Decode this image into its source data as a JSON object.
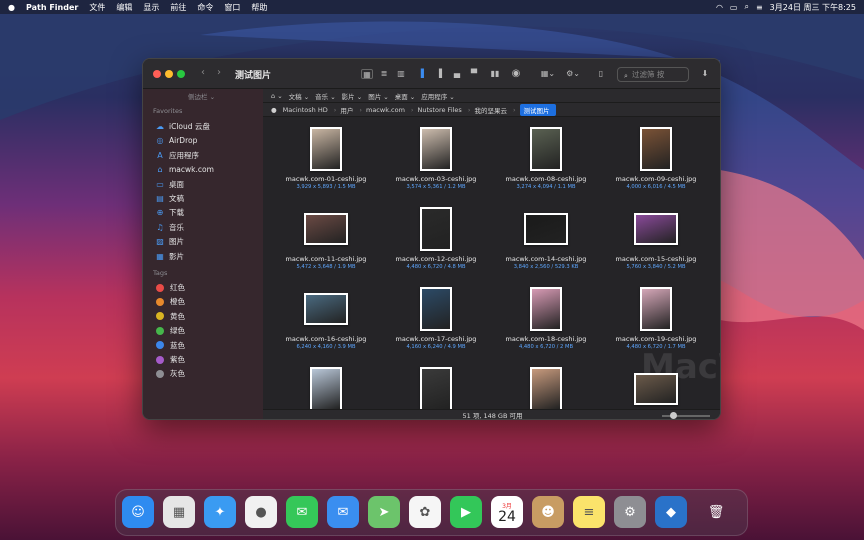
{
  "menubar": {
    "apple": "",
    "app_name": "Path Finder",
    "menus": [
      "文件",
      "编辑",
      "显示",
      "前往",
      "命令",
      "窗口",
      "帮助"
    ],
    "clock": "3月24日 周三 下午8:25"
  },
  "window": {
    "title": "测试图片",
    "search_placeholder": "过滤筛 按"
  },
  "sidebar": {
    "collapse_label": "侧边栏 ⌄",
    "favorites_header": "Favorites",
    "favorites": [
      {
        "label": "iCloud 云盘",
        "icon": "cloud-icon",
        "glyph": "☁"
      },
      {
        "label": "AirDrop",
        "icon": "airdrop-icon",
        "glyph": "◎"
      },
      {
        "label": "应用程序",
        "icon": "applications-icon",
        "glyph": "A"
      },
      {
        "label": "macwk.com",
        "icon": "home-icon",
        "glyph": "⌂"
      },
      {
        "label": "桌面",
        "icon": "desktop-icon",
        "glyph": "▭"
      },
      {
        "label": "文稿",
        "icon": "documents-icon",
        "glyph": "▤"
      },
      {
        "label": "下载",
        "icon": "downloads-icon",
        "glyph": "⊕"
      },
      {
        "label": "音乐",
        "icon": "music-icon",
        "glyph": "♫"
      },
      {
        "label": "图片",
        "icon": "pictures-icon",
        "glyph": "▨"
      },
      {
        "label": "影片",
        "icon": "movies-icon",
        "glyph": "▦"
      }
    ],
    "tags_header": "Tags",
    "tags": [
      {
        "label": "红色",
        "color": "#e94b47"
      },
      {
        "label": "橙色",
        "color": "#e8892c"
      },
      {
        "label": "黄色",
        "color": "#d9b422"
      },
      {
        "label": "绿色",
        "color": "#46b64b"
      },
      {
        "label": "蓝色",
        "color": "#3c86ea"
      },
      {
        "label": "紫色",
        "color": "#a65bc9"
      },
      {
        "label": "灰色",
        "color": "#8e8e93"
      }
    ]
  },
  "pathbar_top": [
    "文稿 ⌄",
    "音乐 ⌄",
    "影片 ⌄",
    "图片 ⌄",
    "桌面 ⌄",
    "应用程序 ⌄"
  ],
  "pathbar": [
    "Macintosh HD",
    "用户",
    "macwk.com",
    "Nutstore Files",
    "我的坚果云",
    "测试图片"
  ],
  "files": [
    {
      "name": "macwk.com-01-ceshi.jpg",
      "meta": "3,929 x 5,893 / 1.5 MB",
      "orient": "portrait",
      "color": "#c9b6a3"
    },
    {
      "name": "macwk.com-03-ceshi.jpg",
      "meta": "3,574 x 5,361 / 1.2 MB",
      "orient": "portrait",
      "color": "#cdbdae"
    },
    {
      "name": "macwk.com-08-ceshi.jpg",
      "meta": "3,274 x 4,094 / 1.1 MB",
      "orient": "portrait",
      "color": "#5a6152"
    },
    {
      "name": "macwk.com-09-ceshi.jpg",
      "meta": "4,000 x 6,016 / 4.5 MB",
      "orient": "portrait",
      "color": "#7a5236"
    },
    {
      "name": "macwk.com-11-ceshi.jpg",
      "meta": "5,472 x 3,648 / 1.9 MB",
      "orient": "landscape",
      "color": "#6b4a44"
    },
    {
      "name": "macwk.com-12-ceshi.jpg",
      "meta": "4,480 x 6,720 / 4.8 MB",
      "orient": "portrait",
      "color": "#2a2a2a"
    },
    {
      "name": "macwk.com-14-ceshi.jpg",
      "meta": "3,840 x 2,560 / 529.3 KB",
      "orient": "landscape",
      "color": "#1a1a1a"
    },
    {
      "name": "macwk.com-15-ceshi.jpg",
      "meta": "5,760 x 3,840 / 5.2 MB",
      "orient": "landscape",
      "color": "#8a4a9a"
    },
    {
      "name": "macwk.com-16-ceshi.jpg",
      "meta": "6,240 x 4,160 / 3.9 MB",
      "orient": "landscape",
      "color": "#4a6a80"
    },
    {
      "name": "macwk.com-17-ceshi.jpg",
      "meta": "4,160 x 6,240 / 4.9 MB",
      "orient": "portrait",
      "color": "#2c4a66"
    },
    {
      "name": "macwk.com-18-ceshi.jpg",
      "meta": "4,480 x 6,720 / 2 MB",
      "orient": "portrait",
      "color": "#d79ab4"
    },
    {
      "name": "macwk.com-19-ceshi.jpg",
      "meta": "4,480 x 6,720 / 1.7 MB",
      "orient": "portrait",
      "color": "#d5a7b8"
    },
    {
      "name": "",
      "meta": "",
      "orient": "portrait",
      "color": "#b9c7d8"
    },
    {
      "name": "",
      "meta": "",
      "orient": "portrait",
      "color": "#3a3a3a"
    },
    {
      "name": "",
      "meta": "",
      "orient": "portrait",
      "color": "#c79a7d"
    },
    {
      "name": "",
      "meta": "",
      "orient": "landscape",
      "color": "#6b5a4a"
    }
  ],
  "status": "51 项, 148 GB 可用",
  "watermark": "MacWk.com",
  "dock": [
    {
      "name": "finder-icon",
      "glyph": "☺",
      "bg": "#2e8bf0"
    },
    {
      "name": "launchpad-icon",
      "glyph": "▦",
      "bg": "#e6e6e6"
    },
    {
      "name": "safari-icon",
      "glyph": "✦",
      "bg": "#3a9bf2"
    },
    {
      "name": "chrome-icon",
      "glyph": "●",
      "bg": "#f1f1f1"
    },
    {
      "name": "messages-icon",
      "glyph": "✉",
      "bg": "#35c759"
    },
    {
      "name": "mail-icon",
      "glyph": "✉",
      "bg": "#3a8ef0"
    },
    {
      "name": "maps-icon",
      "glyph": "➤",
      "bg": "#6cc46b"
    },
    {
      "name": "photos-icon",
      "glyph": "✿",
      "bg": "#f6f6f6"
    },
    {
      "name": "facetime-icon",
      "glyph": "▶",
      "bg": "#33c759"
    },
    {
      "name": "calendar-icon",
      "glyph": "24",
      "bg": "#ffffff",
      "month": "3月"
    },
    {
      "name": "contacts-icon",
      "glyph": "☻",
      "bg": "#c89c63"
    },
    {
      "name": "notes-icon",
      "glyph": "≡",
      "bg": "#fbe36b"
    },
    {
      "name": "system-preferences-icon",
      "glyph": "⚙",
      "bg": "#8e8e93"
    },
    {
      "name": "path-finder-icon",
      "glyph": "◆",
      "bg": "#2a72c9"
    },
    {
      "name": "trash-icon",
      "glyph": "🗑",
      "bg": "transparent"
    }
  ]
}
